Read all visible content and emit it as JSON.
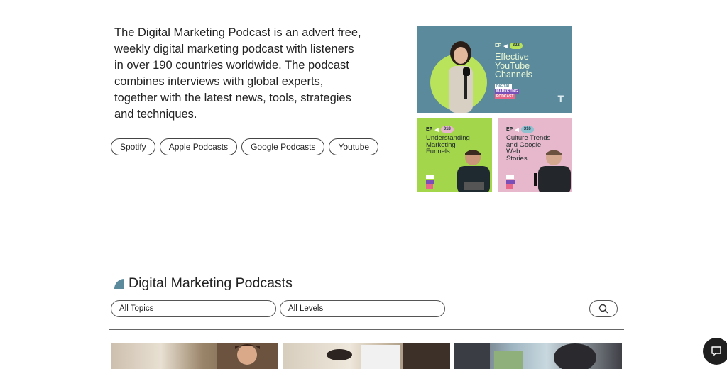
{
  "intro": {
    "text": "The Digital Marketing Podcast is an advert free, weekly digital marketing podcast with listeners in over 190 countries worldwide. The podcast combines interviews with global experts, together with the latest news, tools, strategies and techniques."
  },
  "platforms": [
    "Spotify",
    "Apple Podcasts",
    "Google Podcasts",
    "Youtube"
  ],
  "covers": {
    "main": {
      "ep_label": "EP",
      "ep_number": "322",
      "title_lines": [
        "Effective",
        "YouTube",
        "Channels"
      ],
      "brand": [
        "DIGITAL",
        "MARKETING",
        "PODCAST"
      ]
    },
    "small1": {
      "ep_label": "EP",
      "ep_number": "318",
      "title_lines": [
        "Understanding",
        "Marketing",
        "Funnels"
      ]
    },
    "small2": {
      "ep_label": "EP",
      "ep_number": "316",
      "title_lines": [
        "Culture Trends",
        "and Google",
        "Web",
        "Stories"
      ]
    }
  },
  "section": {
    "title": "Digital Marketing Podcasts"
  },
  "filters": {
    "topics": "All Topics",
    "levels": "All Levels"
  },
  "colors": {
    "teal": "#5a8a9b",
    "lime": "#a4d64b",
    "pink": "#e7b7cb",
    "dark": "#1f1f1f"
  },
  "icons": {
    "search": "search-icon",
    "chat": "chat-icon"
  }
}
